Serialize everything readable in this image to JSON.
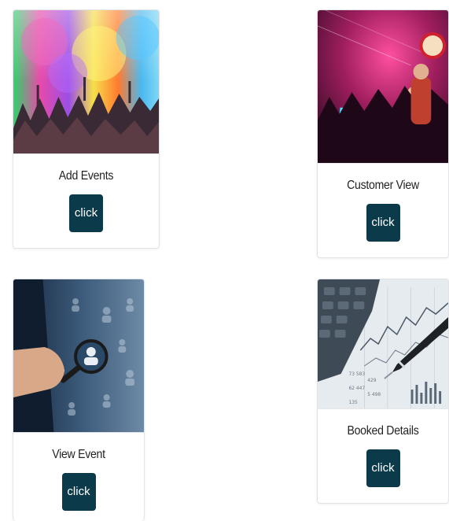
{
  "cards": [
    {
      "title": "Add Events",
      "button_label": "click",
      "image": "color-festival-crowd-photo"
    },
    {
      "title": "Customer View",
      "button_label": "click",
      "image": "nightclub-party-photo"
    },
    {
      "title": "View Event",
      "button_label": "click",
      "image": "magnifier-people-network-photo"
    },
    {
      "title": "Booked Details",
      "button_label": "click",
      "image": "calculator-pen-finance-chart-photo"
    }
  ],
  "colors": {
    "button_bg": "#0b3a4a",
    "button_text": "#ffffff",
    "card_border": "#e1e3e6"
  }
}
